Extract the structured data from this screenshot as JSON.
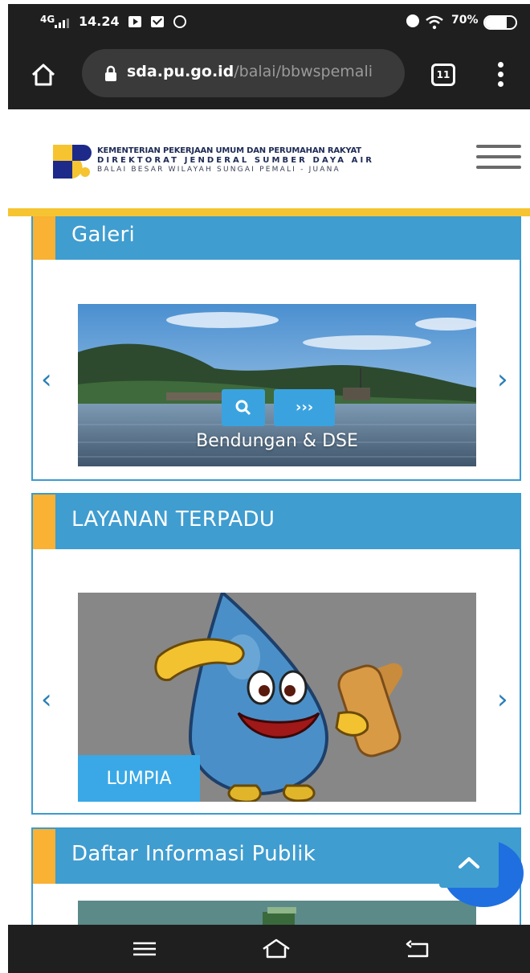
{
  "status_bar": {
    "network": "4G",
    "time": "14.24",
    "battery": "70%",
    "battery_level": 0.7,
    "icons": [
      "youtube-icon",
      "mail-icon",
      "whatsapp-icon",
      "alarm-icon",
      "wifi-icon",
      "battery-icon"
    ]
  },
  "browser": {
    "url_host": "sda.pu.go.id",
    "url_path": "/balai/bbwspemali",
    "tab_count": "11"
  },
  "header": {
    "org_line1": "KEMENTERIAN PEKERJAAN UMUM DAN PERUMAHAN RAKYAT",
    "org_line2": "DIREKTORAT JENDERAL SUMBER DAYA AIR",
    "org_line3": "BALAI BESAR WILAYAH SUNGAI PEMALI - JUANA"
  },
  "galeri": {
    "title": "Galeri",
    "view_button": "›››",
    "caption": "Bendungan & DSE"
  },
  "layanan": {
    "title": "LAYANAN TERPADU",
    "badge": "LUMPIA"
  },
  "daftar": {
    "title": "Daftar Informasi Publik"
  },
  "colors": {
    "accent": "#3f9dd0",
    "accent_stripe": "#f9b233",
    "header_strip": "#f6c431",
    "button": "#3aa3df"
  }
}
